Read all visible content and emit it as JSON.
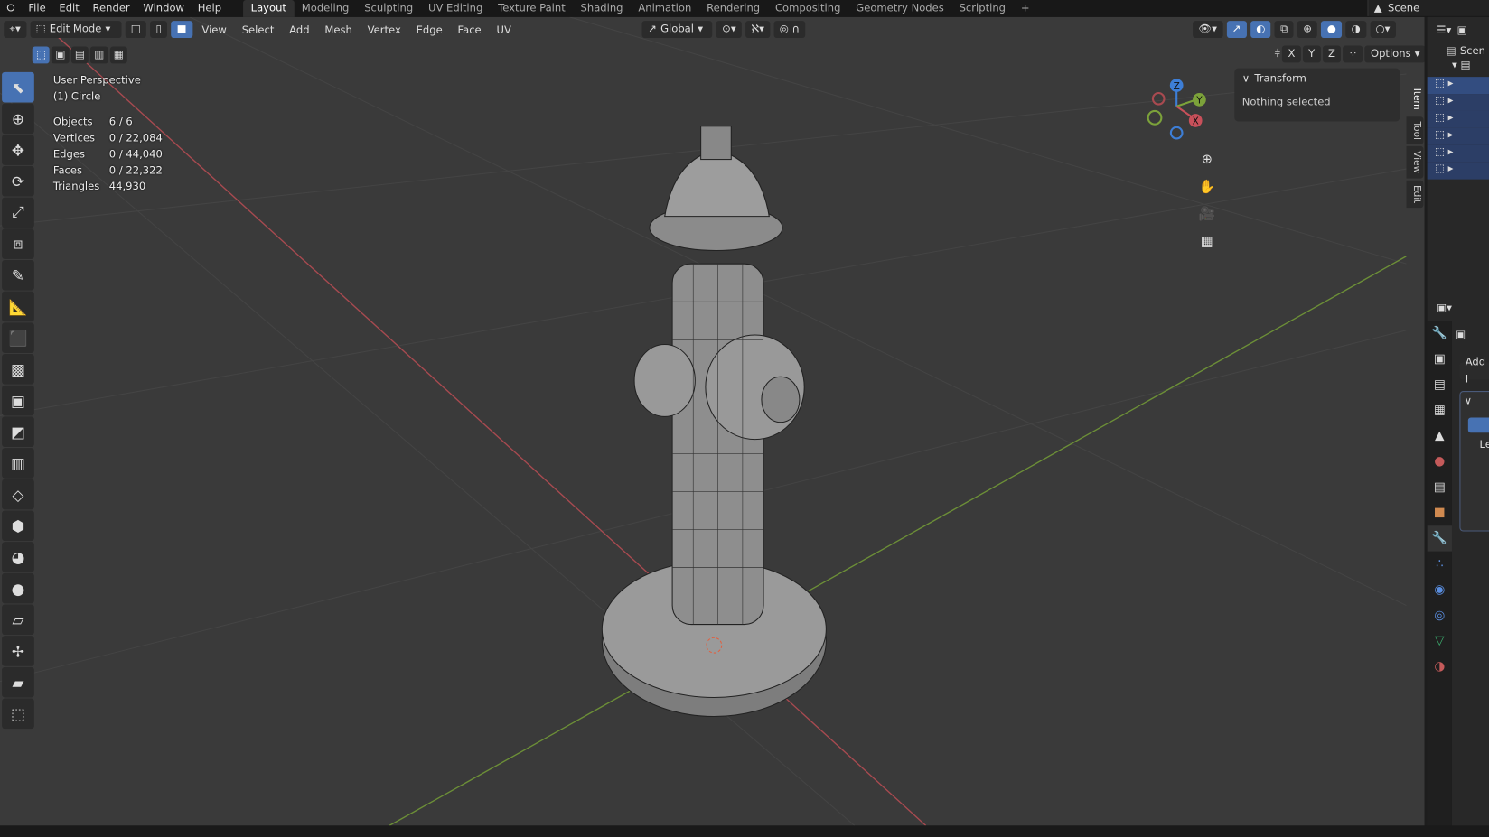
{
  "menu": {
    "items": [
      "File",
      "Edit",
      "Render",
      "Window",
      "Help"
    ]
  },
  "workspaces": {
    "tabs": [
      "Layout",
      "Modeling",
      "Sculpting",
      "UV Editing",
      "Texture Paint",
      "Shading",
      "Animation",
      "Rendering",
      "Compositing",
      "Geometry Nodes",
      "Scripting"
    ],
    "active": "Layout",
    "add": "+"
  },
  "scene": {
    "label": "Scene"
  },
  "header": {
    "mode": "Edit Mode",
    "menus": [
      "View",
      "Select",
      "Add",
      "Mesh",
      "Vertex",
      "Edge",
      "Face",
      "UV"
    ],
    "orientation": "Global",
    "options": "Options",
    "axes": [
      "X",
      "Y",
      "Z"
    ]
  },
  "overlay": {
    "view_name": "User Perspective",
    "object_name": "(1) Circle",
    "stats": [
      {
        "label": "Objects",
        "value": "6 / 6"
      },
      {
        "label": "Vertices",
        "value": "0 / 22,084"
      },
      {
        "label": "Edges",
        "value": "0 / 44,040"
      },
      {
        "label": "Faces",
        "value": "0 / 22,322"
      },
      {
        "label": "Triangles",
        "value": "44,930"
      }
    ]
  },
  "npanel": {
    "title": "Transform",
    "message": "Nothing selected",
    "tabs": [
      "Item",
      "Tool",
      "View",
      "Edit"
    ]
  },
  "gizmo": {
    "z": "Z",
    "y": "Y",
    "x": "X"
  },
  "outliner": {
    "scene_label": "Scen"
  },
  "properties": {
    "add_label": "Add I",
    "item_label": "Le"
  },
  "colors": {
    "accent": "#4772b3",
    "x_axis": "#c8505a",
    "y_axis": "#7ca23a",
    "z_axis": "#3d7ed6",
    "viewport": "#3a3a3a"
  }
}
